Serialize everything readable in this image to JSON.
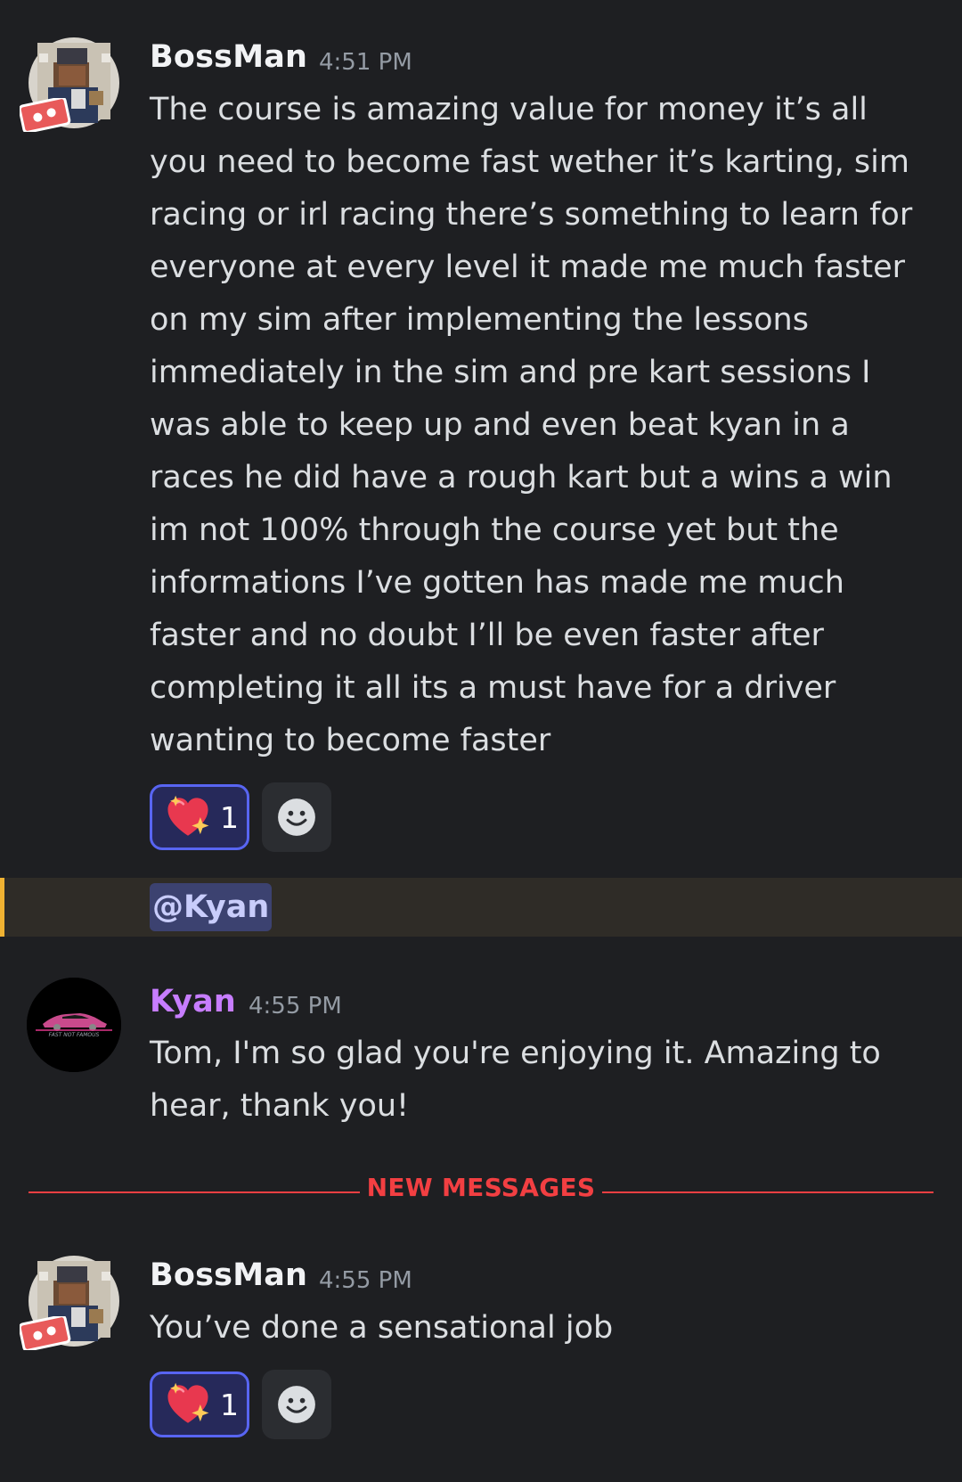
{
  "messages": [
    {
      "username": "BossMan",
      "username_color": "#f2f3f5",
      "timestamp": "4:51 PM",
      "avatar_icon": "pixel-avatar-photo",
      "content": "The course is amazing value for money it’s all\nyou need to become fast wether it’s karting, sim\nracing or irl racing there’s something to learn for\neveryone at every level it made me much faster\non my sim after implementing the lessons\nimmediately in the sim and pre kart sessions I\nwas able to keep up and even beat kyan in a\nraces he did have a rough kart but a wins a win\nim not 100% through the course yet but the\ninformations I’ve gotten has made me much\nfaster and no doubt I’ll be even faster after\ncompleting it all its a must have for a driver\nwanting to become faster",
      "reaction": {
        "emoji": "sparkling-heart",
        "count": "1"
      }
    },
    {
      "mention": "@Kyan",
      "highlight_color": "#f0b232"
    },
    {
      "username": "Kyan",
      "username_color": "#c77dff",
      "timestamp": "4:55 PM",
      "avatar_icon": "car-logo-avatar",
      "avatar_text": "FAST NOT FAMOUS",
      "content": "Tom, I'm so glad you're enjoying it. Amazing to\nhear, thank you!"
    },
    {
      "divider": "NEW MESSAGES",
      "divider_color": "#f23f42"
    },
    {
      "username": "BossMan",
      "username_color": "#f2f3f5",
      "timestamp": "4:55 PM",
      "avatar_icon": "pixel-avatar-photo",
      "content": "You’ve done a sensational job",
      "reaction": {
        "emoji": "sparkling-heart",
        "count": "1"
      }
    }
  ]
}
